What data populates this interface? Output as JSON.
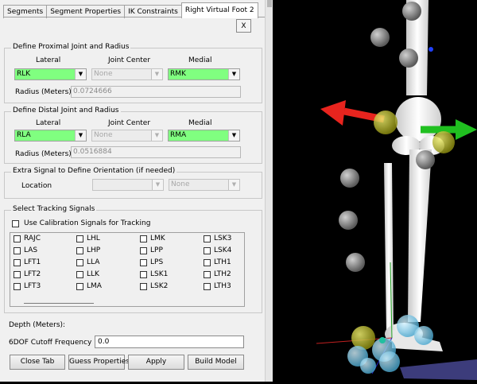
{
  "tabs": [
    {
      "label": "Segments",
      "active": false
    },
    {
      "label": "Segment Properties",
      "active": false
    },
    {
      "label": "IK Constraints",
      "active": false
    },
    {
      "label": "Right Virtual Foot 2",
      "active": true
    }
  ],
  "close_label": "X",
  "proximal": {
    "title": "Define Proximal Joint and Radius",
    "col_lateral": "Lateral",
    "col_center": "Joint Center",
    "col_medial": "Medial",
    "lateral": "RLK",
    "center": "None",
    "medial": "RMK",
    "radius_label": "Radius (Meters)",
    "radius_value": "0.0724666"
  },
  "distal": {
    "title": "Define Distal Joint and Radius",
    "col_lateral": "Lateral",
    "col_center": "Joint Center",
    "col_medial": "Medial",
    "lateral": "RLA",
    "center": "None",
    "medial": "RMA",
    "radius_label": "Radius (Meters)",
    "radius_value": "0.0516884"
  },
  "extra": {
    "title": "Extra Signal to Define Orientation (if needed)",
    "location_label": "Location",
    "location_value": "",
    "second_value": "None"
  },
  "tracking": {
    "title": "Select Tracking Signals",
    "use_calibration_label": "Use Calibration Signals for Tracking",
    "columns": [
      [
        "RAJC",
        "LAS",
        "LFT1",
        "LFT2",
        "LFT3"
      ],
      [
        "LHL",
        "LHP",
        "LLA",
        "LLK",
        "LMA"
      ],
      [
        "LMK",
        "LPP",
        "LPS",
        "LSK1",
        "LSK2"
      ],
      [
        "LSK3",
        "LSK4",
        "LTH1",
        "LTH2",
        "LTH3"
      ]
    ]
  },
  "depth_label": "Depth (Meters):",
  "cutoff_label": "6DOF Cutoff Frequency",
  "cutoff_value": "0.0",
  "buttons": {
    "close_tab": "Close Tab",
    "guess_properties": "Guess Properties",
    "apply": "Apply",
    "build_model": "Build Model"
  },
  "colors": {
    "selected_marker": "#80ff80",
    "arrow_x": "#e8241e",
    "arrow_y": "#20c020",
    "bone": "#f4f4f4",
    "marker_gray": "#8a8a8a",
    "marker_yellow": "#b8b81e",
    "marker_cyan": "#6ec8e8"
  }
}
